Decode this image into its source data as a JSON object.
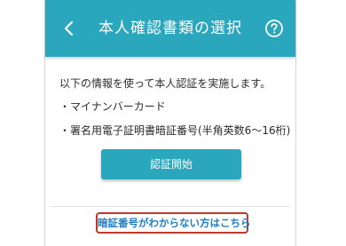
{
  "header": {
    "back_icon": "chevron-left-icon",
    "title": "本人確認書類の選択",
    "help_icon": "question-circle-icon",
    "background_color": "#2aa6bd"
  },
  "main": {
    "intro": "以下の情報を使って本人認証を実施します。",
    "documents": [
      "・マイナンバーカード",
      "・署名用電子証明書暗証番号(半角英数6〜16桁)"
    ],
    "auth_button_label": "認証開始",
    "forgot_link": "暗証番号がわからない方はこちら"
  },
  "colors": {
    "accent": "#2aa6bd",
    "link": "#1f7ec4",
    "highlight_border": "#c0392b"
  }
}
